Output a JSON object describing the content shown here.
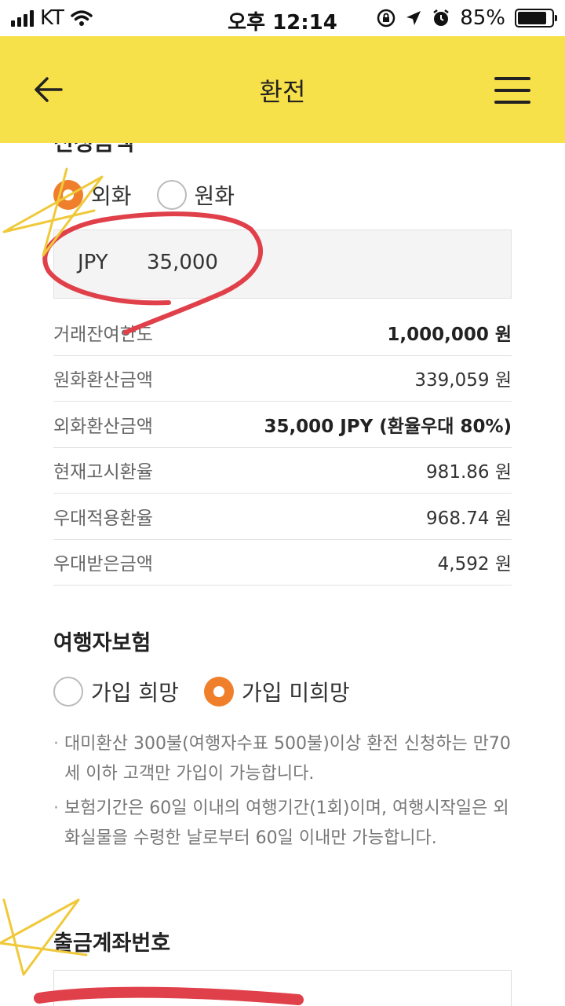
{
  "status_bar": {
    "carrier": "KT",
    "time": "오후 12:14",
    "battery": "85%",
    "battery_level": 0.85
  },
  "header": {
    "title": "환전",
    "back_icon": "arrow-left-icon",
    "menu_icon": "hamburger-menu-icon"
  },
  "amount_section": {
    "title": "신청금액",
    "options": [
      {
        "label": "외화",
        "checked": true
      },
      {
        "label": "원화",
        "checked": false
      }
    ],
    "currency": "JPY",
    "amount": "35,000"
  },
  "info_rows": [
    {
      "label": "거래잔여한도",
      "value": "1,000,000 원",
      "bold": true
    },
    {
      "label": "원화환산금액",
      "value": "339,059 원",
      "bold": false
    },
    {
      "label": "외화환산금액",
      "value": "35,000 JPY (환율우대 80%)",
      "bold": true
    },
    {
      "label": "현재고시환율",
      "value": "981.86 원",
      "bold": false
    },
    {
      "label": "우대적용환율",
      "value": "968.74 원",
      "bold": false
    },
    {
      "label": "우대받은금액",
      "value": "4,592 원",
      "bold": false
    }
  ],
  "insurance": {
    "title": "여행자보험",
    "options": [
      {
        "label": "가입 희망",
        "checked": false
      },
      {
        "label": "가입 미희망",
        "checked": true
      }
    ],
    "notes": [
      "대미환산 300불(여행자수표 500불)이상 환전 신청하는 만70세 이하 고객만 가입이 가능합니다.",
      "보험기간은 60일 이내의 여행기간(1회)이며, 여행시작일은 외화실물을 수령한 날로부터 60일 이내만 가능합니다."
    ]
  },
  "account": {
    "title": "출금계좌번호"
  },
  "colors": {
    "header_bg": "#f7e14a",
    "radio_checked": "#ef7f2a",
    "annotation_red": "#e0404a",
    "annotation_yellow": "#f0c93a"
  }
}
